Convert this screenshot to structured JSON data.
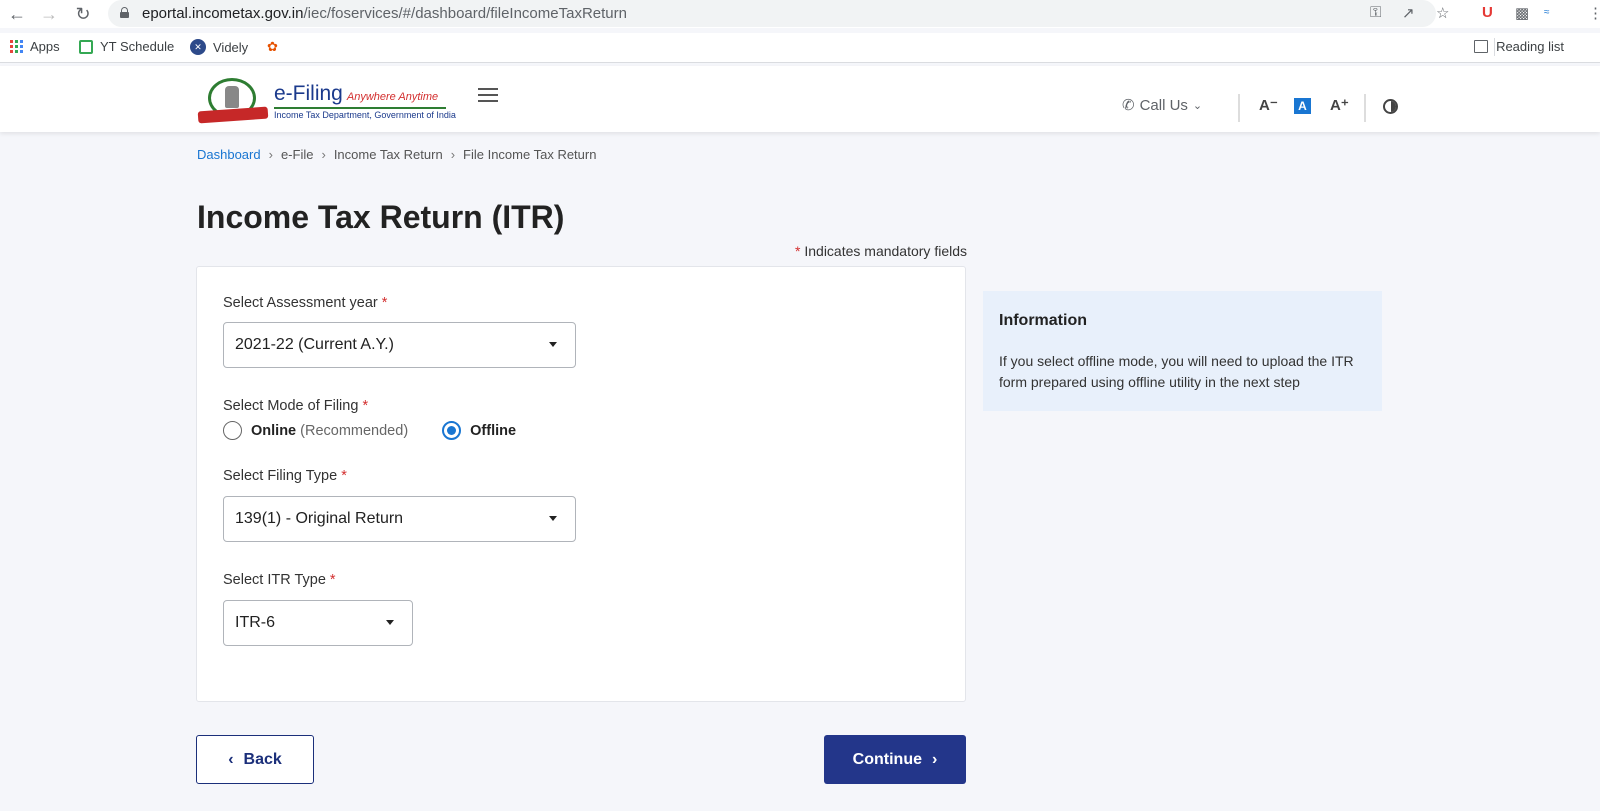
{
  "browser": {
    "url_domain": "eportal.incometax.gov.in",
    "url_path": "/iec/foservices/#/dashboard/fileIncomeTaxReturn",
    "bookmarks": [
      {
        "label": "Apps",
        "icon": "apps-grid-icon"
      },
      {
        "label": "YT Schedule",
        "icon": "sheet-icon"
      },
      {
        "label": "Videly",
        "icon": "videly-icon"
      },
      {
        "label": "",
        "icon": "bird-icon"
      }
    ],
    "reading_list": "Reading list"
  },
  "header": {
    "brand_main": "e-Filing",
    "brand_tagline": "Anywhere Anytime",
    "brand_sub": "Income Tax Department, Government of India",
    "call_us": "Call Us",
    "font_decrease": "A⁻",
    "font_normal": "A",
    "font_increase": "A⁺"
  },
  "breadcrumb": [
    {
      "label": "Dashboard",
      "link": true
    },
    {
      "label": "e-File",
      "link": false
    },
    {
      "label": "Income Tax Return",
      "link": false
    },
    {
      "label": "File Income Tax Return",
      "link": false
    }
  ],
  "breadcrumb_separator": "›",
  "page": {
    "title": "Income Tax Return (ITR)",
    "mandatory_star": "*",
    "mandatory_note": "Indicates mandatory fields"
  },
  "form": {
    "assessment_year": {
      "label": "Select Assessment year",
      "value": "2021-22  (Current A.Y.)"
    },
    "mode_of_filing": {
      "label": "Select Mode of Filing",
      "options": [
        {
          "label": "Online",
          "hint": "(Recommended)",
          "checked": false
        },
        {
          "label": "Offline",
          "hint": "",
          "checked": true
        }
      ]
    },
    "filing_type": {
      "label": "Select Filing Type",
      "value": "139(1) - Original Return"
    },
    "itr_type": {
      "label": "Select ITR Type",
      "value": "ITR-6"
    },
    "required_mark": "*"
  },
  "info": {
    "title": "Information",
    "text": "If you select offline mode, you will need to upload the ITR form prepared using offline utility in the next step"
  },
  "actions": {
    "back": "Back",
    "continue": "Continue"
  },
  "colors": {
    "primary": "#23368a",
    "link": "#1976d2",
    "required": "#d32f2f",
    "info_bg": "#e8f0fb"
  }
}
